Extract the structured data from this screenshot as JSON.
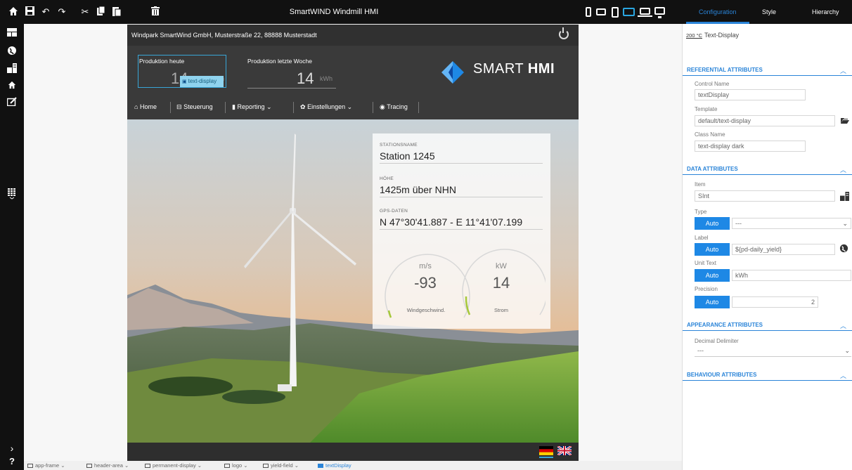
{
  "window": {
    "title": "SmartWIND Windmill HMI"
  },
  "toolbar": {
    "icons": [
      "home-icon",
      "save-icon",
      "undo-icon",
      "redo-icon",
      "cut-icon",
      "copy-icon",
      "paste-icon",
      "delete-icon"
    ],
    "devices": [
      "phone-portrait",
      "phone-landscape",
      "tablet-portrait",
      "tablet-landscape",
      "laptop",
      "desktop"
    ],
    "active_device": "tablet-landscape"
  },
  "right_tabs": {
    "configuration": "Configuration",
    "style": "Style",
    "hierarchy": "Hierarchy",
    "active": "Configuration"
  },
  "left_sidebar": {
    "icons": [
      "layout-icon",
      "globe-icon",
      "data-items-icon",
      "home-icon",
      "edit-icon",
      "keypad-icon",
      "expand-icon",
      "help-icon"
    ],
    "help_label": "?"
  },
  "hmi": {
    "address": "Windpark SmartWind GmbH, Musterstraße 22, 88888 Musterstadt",
    "yield_today": {
      "label": "Produktion heute",
      "value": "14",
      "unit": "kWh"
    },
    "yield_week": {
      "label": "Produktion letzte Woche",
      "value": "14",
      "unit": "kWh"
    },
    "selection_badge": "text-display",
    "logo": {
      "light": "SMART",
      "bold": "HMI"
    },
    "nav": [
      {
        "label": "Home",
        "icon": "home-icon"
      },
      {
        "label": "Steuerung",
        "icon": "control-icon"
      },
      {
        "label": "Reporting",
        "icon": "report-icon",
        "dropdown": true
      },
      {
        "label": "Einstellungen",
        "icon": "gear-icon",
        "dropdown": true
      },
      {
        "label": "Tracing",
        "icon": "target-icon"
      }
    ],
    "station": {
      "name_label": "STATIONSNAME",
      "name": "Station 1245",
      "height_label": "HÖHE",
      "height": "1425m über NHN",
      "gps_label": "GPS-DATEN",
      "gps": "N 47°30'41.887 - E 11°41'07.199"
    },
    "gauges": [
      {
        "unit": "m/s",
        "value": "-93",
        "caption": "Windgeschwind."
      },
      {
        "unit": "kW",
        "value": "14",
        "caption": "Strom"
      }
    ],
    "languages": [
      "de",
      "en"
    ],
    "active_language": "de"
  },
  "properties": {
    "header": {
      "prefix": "200 °C",
      "title": "Text-Display"
    },
    "sections": [
      {
        "title": "REFERENTIAL ATTRIBUTES",
        "expanded": true
      },
      {
        "title": "DATA ATTRIBUTES",
        "expanded": true
      },
      {
        "title": "APPEARANCE ATTRIBUTES",
        "expanded": true
      },
      {
        "title": "BEHAVIOUR ATTRIBUTES",
        "expanded": true
      }
    ],
    "control_name": {
      "label": "Control Name",
      "value": "textDisplay"
    },
    "template": {
      "label": "Template",
      "value": "default/text-display"
    },
    "class_name": {
      "label": "Class Name",
      "value": "text-display dark"
    },
    "item": {
      "label": "Item",
      "value": "SInt"
    },
    "type": {
      "label": "Type",
      "auto": "Auto",
      "value": "---"
    },
    "label": {
      "label": "Label",
      "auto": "Auto",
      "value": "${pd-daily_yield}"
    },
    "unit_text": {
      "label": "Unit Text",
      "auto": "Auto",
      "value": "kWh"
    },
    "precision": {
      "label": "Precision",
      "auto": "Auto",
      "value": "2"
    },
    "decimal_delimiter": {
      "label": "Decimal Delimiter",
      "value": "---"
    }
  },
  "breadcrumb": [
    {
      "label": "app-frame",
      "active": false
    },
    {
      "label": "header-area",
      "active": false
    },
    {
      "label": "permanent-display",
      "active": false
    },
    {
      "label": "logo",
      "active": false
    },
    {
      "label": "yield-field",
      "active": false
    },
    {
      "label": "textDisplay",
      "active": true
    }
  ],
  "colors": {
    "accent": "#2a84d8",
    "selection": "#38a6d8",
    "dark": "#111111",
    "hmi_bg": "#3a3a3a"
  }
}
